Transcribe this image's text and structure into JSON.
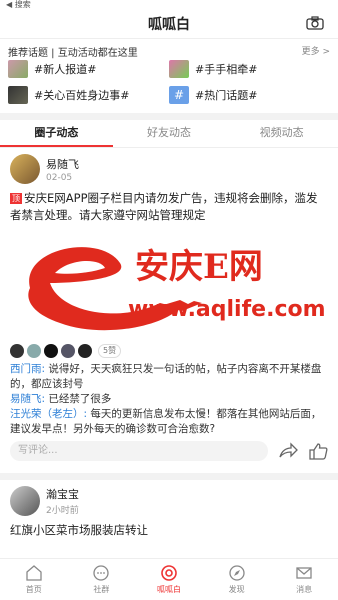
{
  "status": {
    "back_label": "◀ 搜索"
  },
  "header": {
    "title": "呱呱白"
  },
  "topics": {
    "heading": "推荐话题 | 互动活动都在这里",
    "more": "更多 >",
    "items": [
      {
        "label": "#新人报道#"
      },
      {
        "label": "#手手相牵#"
      },
      {
        "label": "#关心百姓身边事#"
      },
      {
        "label": "#热门话题#"
      }
    ]
  },
  "tabs": [
    {
      "label": "圈子动态"
    },
    {
      "label": "好友动态"
    },
    {
      "label": "视频动态"
    }
  ],
  "post1": {
    "user": "易随飞",
    "date": "02-05",
    "tag": "顶",
    "content": "安庆E网APP圈子栏目内请勿发广告，违规将会删除，滥发者禁言处理。请大家遵守网站管理规定",
    "banner_title": "安庆E网",
    "banner_url": "www.aqlife.com",
    "likes": "5赞",
    "comments": [
      {
        "name": "西门雨:",
        "text": " 说得好，天天疯狂只发一句话的帖，帖子内容离不开某楼盘的，都应该封号"
      },
      {
        "name": "易随飞:",
        "text": " 已经禁了很多"
      },
      {
        "name": "汪光荣（老左）:",
        "text": " 每天的更新信息发布太慢！都落在其他网站后面，建议发早点！另外每天的确诊数可合治愈数?"
      }
    ],
    "comment_placeholder": "写评论..."
  },
  "post2": {
    "user": "瀚宝宝",
    "date": "2小时前",
    "content": "红旗小区菜市场服装店转让"
  },
  "nav": [
    {
      "label": "首页"
    },
    {
      "label": "社群"
    },
    {
      "label": "呱呱白"
    },
    {
      "label": "发现"
    },
    {
      "label": "消息"
    }
  ],
  "colors": {
    "accent": "#e33333",
    "link": "#2d7fd6"
  }
}
